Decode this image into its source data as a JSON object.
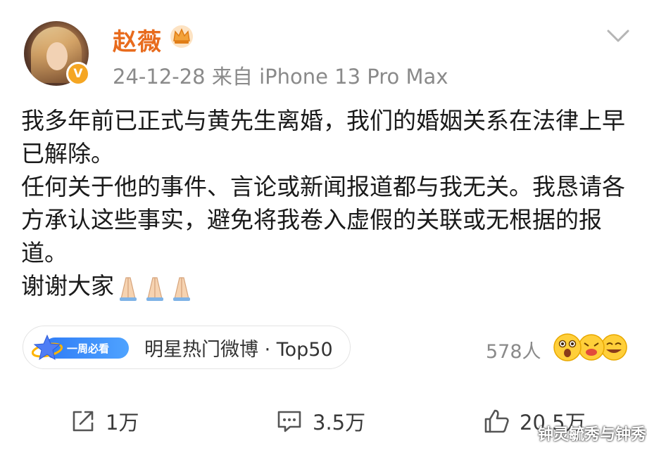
{
  "post": {
    "author": "赵薇",
    "meta": "24-12-28  来自 iPhone 13 Pro Max",
    "paragraphs": [
      "我多年前已正式与黄先生离婚，我们的婚姻关系在法律上早已解除。",
      "任何关于他的事件、言论或新闻报道都与我无关。我恳请各方承认这些事实，避免将我卷入虚假的关联或无根据的报道。",
      "谢谢大家"
    ],
    "badge_label": "一周必看",
    "topic": "明星热门微博 · Top50",
    "reader_count": "578人"
  },
  "actions": {
    "repost": "1万",
    "comment": "3.5万",
    "like": "20.5万"
  },
  "watermark": "钟灵毓秀与钟秀",
  "icons": [
    "avatar",
    "verified-badge-icon",
    "crown-icon",
    "chevron-down-icon",
    "folded-hands-icon",
    "star-badge-icon",
    "emoji-faces-icon",
    "repost-icon",
    "comment-icon",
    "like-icon"
  ],
  "colors": {
    "author": "#e86b1d",
    "meta": "#8a8a8a",
    "badge": "#2f7cf6",
    "verify": "#f5a623"
  }
}
